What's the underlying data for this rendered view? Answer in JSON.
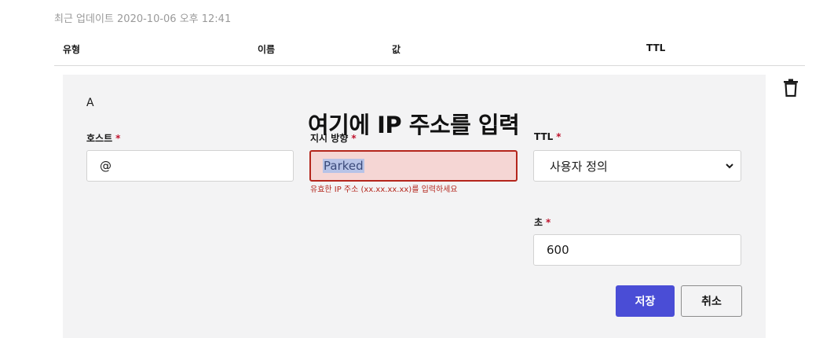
{
  "last_updated": "최근 업데이트 2020-10-06 오후 12:41",
  "table_headers": {
    "type": "유형",
    "name": "이름",
    "value": "값",
    "ttl": "TTL"
  },
  "record": {
    "type": "A",
    "overlay_title": "여기에 IP 주소를 입력",
    "host": {
      "label": "호스트",
      "required_marker": "*",
      "value": "@"
    },
    "points_to": {
      "label": "지시 방향",
      "required_marker": "*",
      "value": "Parked",
      "error": "유효한 IP 주소 (xx.xx.xx.xx)를 입력하세요"
    },
    "ttl": {
      "label": "TTL",
      "required_marker": "*",
      "selected_option": "사용자 정의"
    },
    "seconds": {
      "label": "초",
      "required_marker": "*",
      "value": "600"
    }
  },
  "buttons": {
    "save": "저장",
    "cancel": "취소"
  },
  "icons": {
    "delete": "trash-icon",
    "dropdown": "chevron-down-icon"
  },
  "colors": {
    "primary": "#4a4dd6",
    "error": "#b4261c",
    "error_bg": "#f5d6d4",
    "panel_bg": "#f3f3f4",
    "required": "#c0152f"
  }
}
